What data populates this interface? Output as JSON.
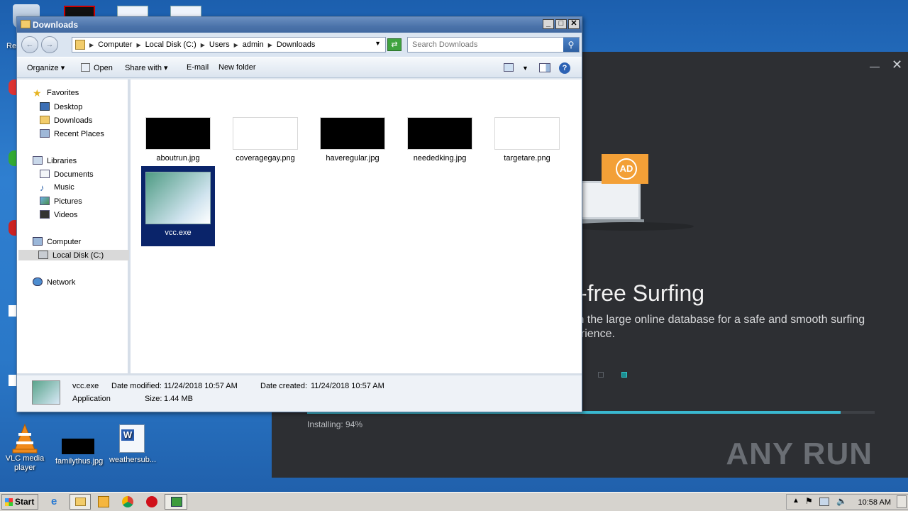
{
  "desktop": {
    "icons": [
      {
        "label": "VLC media player"
      },
      {
        "label": "familythus.jpg"
      },
      {
        "label": "weathersub..."
      }
    ],
    "partial_label": "Re"
  },
  "installer": {
    "headline": "-free Surfing",
    "subtext": "th the large online database for a safe and smooth surfing erience.",
    "status": "Installing: 94%",
    "progress": 0.94,
    "brand": "ANY RUN",
    "ad_badge": "AD",
    "close": "✕",
    "minimize": "—",
    "accent": "#3ab8d0"
  },
  "explorer": {
    "title": "Downloads",
    "breadcrumb": [
      "Computer",
      "Local Disk (C:)",
      "Users",
      "admin",
      "Downloads"
    ],
    "search_placeholder": "Search Downloads",
    "toolbar": {
      "organize": "Organize",
      "open": "Open",
      "share_with": "Share with",
      "email": "E-mail",
      "new_folder": "New folder"
    },
    "nav": {
      "favorites": "Favorites",
      "desktop": "Desktop",
      "downloads": "Downloads",
      "recent": "Recent Places",
      "libraries": "Libraries",
      "documents": "Documents",
      "music": "Music",
      "pictures": "Pictures",
      "videos": "Videos",
      "computer": "Computer",
      "local_disk": "Local Disk (C:)",
      "network": "Network"
    },
    "files": [
      {
        "name": "aboutrun.jpg"
      },
      {
        "name": "coveragegay.png"
      },
      {
        "name": "haveregular.jpg"
      },
      {
        "name": "neededking.jpg"
      },
      {
        "name": "targetare.png"
      },
      {
        "name": "vcc.exe"
      }
    ],
    "details": {
      "name": "vcc.exe",
      "type": "Application",
      "modified_label": "Date modified:",
      "modified": "11/24/2018 10:57 AM",
      "created_label": "Date created:",
      "created": "11/24/2018 10:57 AM",
      "size_label": "Size:",
      "size": "1.44 MB"
    }
  },
  "taskbar": {
    "start": "Start",
    "clock": "10:58 AM"
  }
}
